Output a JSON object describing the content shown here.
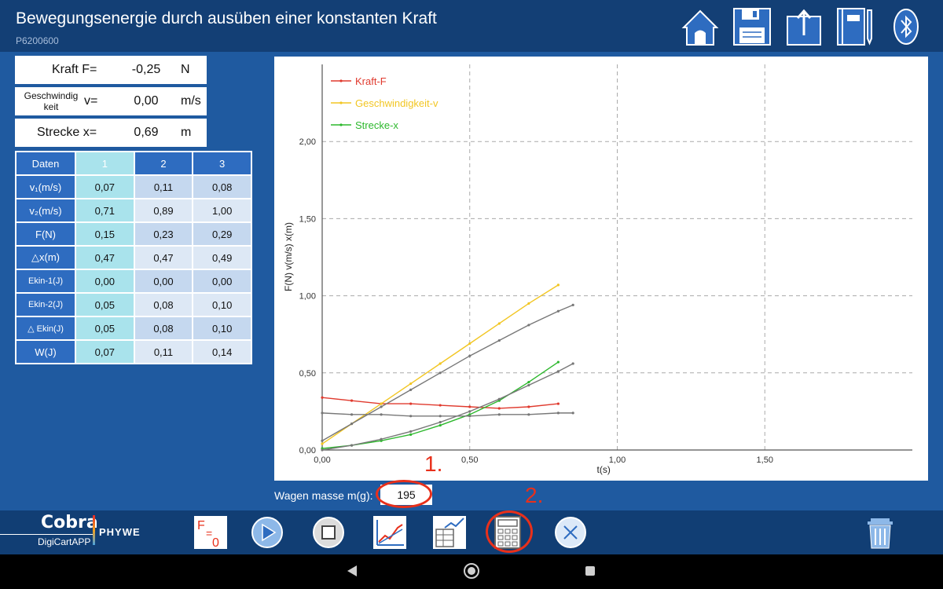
{
  "header": {
    "title": "Bewegungsenergie durch ausüben einer konstanten Kraft",
    "id": "P6200600"
  },
  "readouts": {
    "force": {
      "label": "Kraft F=",
      "value": "-0,25",
      "unit": "N"
    },
    "velocity": {
      "label_small": "Geschwindigkeit",
      "label": "v=",
      "value": "0,00",
      "unit": "m/s"
    },
    "distance": {
      "label": "Strecke x=",
      "value": "0,69",
      "unit": "m"
    }
  },
  "table": {
    "headers": [
      "Daten",
      "1",
      "2",
      "3"
    ],
    "rows": [
      {
        "label": "v₁(m/s)",
        "values": [
          "0,07",
          "0,11",
          "0,08"
        ]
      },
      {
        "label": "v₂(m/s)",
        "values": [
          "0,71",
          "0,89",
          "1,00"
        ]
      },
      {
        "label": "F(N)",
        "values": [
          "0,15",
          "0,23",
          "0,29"
        ]
      },
      {
        "label": "△x(m)",
        "values": [
          "0,47",
          "0,47",
          "0,49"
        ]
      },
      {
        "label": "Ekin-1(J)",
        "values": [
          "0,00",
          "0,00",
          "0,00"
        ]
      },
      {
        "label": "Ekin-2(J)",
        "values": [
          "0,05",
          "0,08",
          "0,10"
        ]
      },
      {
        "label": "△ Ekin(J)",
        "values": [
          "0,05",
          "0,08",
          "0,10"
        ]
      },
      {
        "label": "W(J)",
        "values": [
          "0,07",
          "0,11",
          "0,14"
        ]
      }
    ]
  },
  "mass": {
    "label": "Wagen masse m(g):",
    "value": "195"
  },
  "steps": {
    "one": "1.",
    "two": "2."
  },
  "logo": {
    "cobra": "Cobra",
    "digicart": "DigiCartAPP",
    "phywe": "PHYWE"
  },
  "colors": {
    "header": "#133f75",
    "background": "#1f5aa0",
    "accent": "#e8301b",
    "table_header": "#2e6cc0"
  },
  "chart_data": {
    "type": "line",
    "xlabel": "t(s)",
    "ylabel": "F(N) v(m/s) x(m)",
    "xlim": [
      0,
      2.0
    ],
    "ylim": [
      0,
      2.5
    ],
    "x_ticks": [
      "0,00",
      "0,50",
      "1,00",
      "1,50"
    ],
    "y_ticks": [
      "0,00",
      "0,50",
      "1,00",
      "1,50",
      "2,00"
    ],
    "x_tick_values": [
      0,
      0.5,
      1.0,
      1.5
    ],
    "y_tick_values": [
      0,
      0.5,
      1.0,
      1.5,
      2.0
    ],
    "grid": true,
    "legend_position": "top-left",
    "series": [
      {
        "name": "Kraft-F",
        "color": "#e03a2e",
        "x": [
          0,
          0.1,
          0.2,
          0.3,
          0.4,
          0.5,
          0.6,
          0.7,
          0.8
        ],
        "y": [
          0.34,
          0.32,
          0.3,
          0.3,
          0.29,
          0.28,
          0.27,
          0.28,
          0.3
        ]
      },
      {
        "name": "Geschwindigkeit-v",
        "color": "#f2c623",
        "x": [
          0,
          0.1,
          0.2,
          0.3,
          0.4,
          0.5,
          0.6,
          0.7,
          0.8
        ],
        "y": [
          0.04,
          0.17,
          0.3,
          0.43,
          0.56,
          0.69,
          0.82,
          0.95,
          1.07
        ]
      },
      {
        "name": "Strecke-x",
        "color": "#2db82d",
        "x": [
          0,
          0.1,
          0.2,
          0.3,
          0.4,
          0.5,
          0.6,
          0.7,
          0.8
        ],
        "y": [
          0.01,
          0.03,
          0.06,
          0.1,
          0.16,
          0.23,
          0.32,
          0.44,
          0.57
        ]
      },
      {
        "color": "#777777",
        "x": [
          0,
          0.1,
          0.2,
          0.3,
          0.4,
          0.5,
          0.6,
          0.7,
          0.8,
          0.85
        ],
        "y": [
          0.24,
          0.23,
          0.23,
          0.22,
          0.22,
          0.22,
          0.23,
          0.23,
          0.24,
          0.24
        ]
      },
      {
        "color": "#777777",
        "x": [
          0,
          0.1,
          0.2,
          0.3,
          0.4,
          0.5,
          0.6,
          0.7,
          0.8,
          0.85
        ],
        "y": [
          0.06,
          0.17,
          0.28,
          0.39,
          0.5,
          0.61,
          0.71,
          0.81,
          0.9,
          0.94
        ]
      },
      {
        "color": "#777777",
        "x": [
          0,
          0.1,
          0.2,
          0.3,
          0.4,
          0.5,
          0.6,
          0.7,
          0.8,
          0.85
        ],
        "y": [
          0.0,
          0.03,
          0.07,
          0.12,
          0.18,
          0.25,
          0.33,
          0.42,
          0.51,
          0.56
        ]
      }
    ]
  }
}
